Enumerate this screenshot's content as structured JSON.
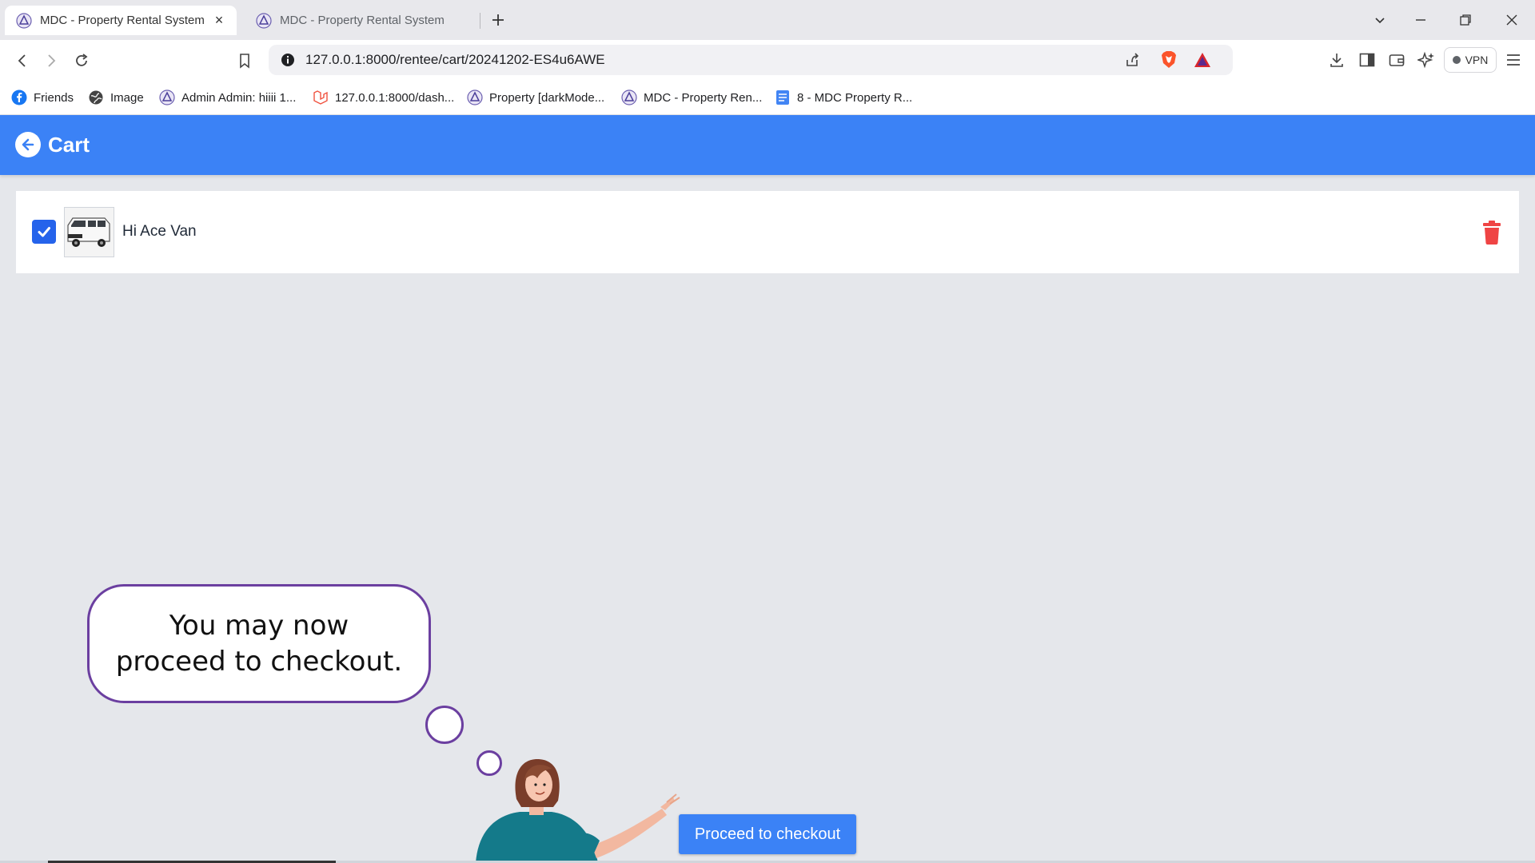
{
  "browser": {
    "tabs": [
      {
        "title": "MDC - Property Rental System",
        "active": true
      },
      {
        "title": "MDC - Property Rental System",
        "active": false
      }
    ],
    "url": "127.0.0.1:8000/rentee/cart/20241202-ES4u6AWE",
    "vpn_label": "VPN",
    "bookmarks": [
      {
        "label": "Friends",
        "icon": "facebook-icon"
      },
      {
        "label": "Image",
        "icon": "globe-icon"
      },
      {
        "label": "Admin Admin: hiiii 1...",
        "icon": "mdc-logo-icon"
      },
      {
        "label": "127.0.0.1:8000/dash...",
        "icon": "laravel-icon"
      },
      {
        "label": "Property [darkMode...",
        "icon": "mdc-logo-icon"
      },
      {
        "label": "MDC - Property Ren...",
        "icon": "mdc-logo-icon"
      },
      {
        "label": "8 - MDC Property R...",
        "icon": "docs-icon"
      }
    ]
  },
  "header": {
    "title": "Cart"
  },
  "cart": {
    "items": [
      {
        "name": "Hi Ace Van",
        "checked": true
      }
    ]
  },
  "bubble": {
    "text": "You may now proceed to checkout."
  },
  "checkout": {
    "label": "Proceed to checkout"
  },
  "colors": {
    "primary": "#3b82f6",
    "delete": "#ef4444",
    "bubble_border": "#6b3fa0",
    "page_bg": "#e5e7eb"
  }
}
